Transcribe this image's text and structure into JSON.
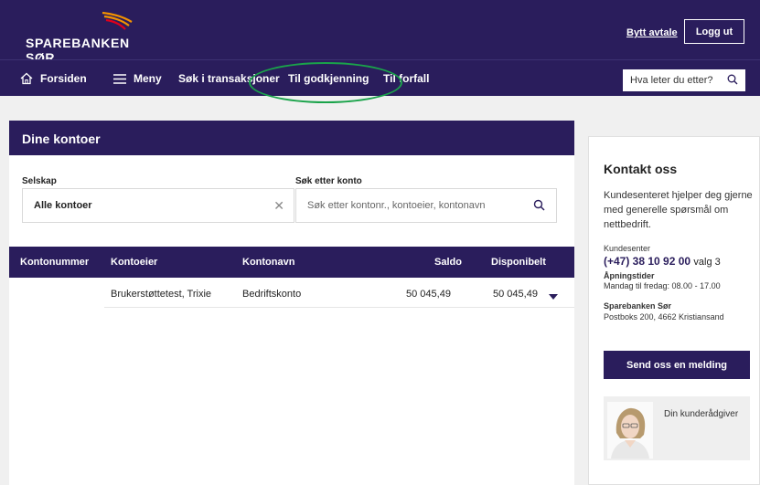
{
  "header": {
    "brand": "SPAREBANKEN SØR",
    "switch_agreement": "Bytt avtale",
    "logout": "Logg ut"
  },
  "nav": {
    "home": "Forsiden",
    "menu": "Meny",
    "search_transactions": "Søk i transaksjoner",
    "approval": "Til godkjenning",
    "due": "Til forfall",
    "search_placeholder": "Hva leter du etter?"
  },
  "accounts": {
    "title": "Dine kontoer",
    "company_label": "Selskap",
    "company_value": "Alle kontoer",
    "search_label": "Søk etter konto",
    "search_placeholder": "Søk etter kontonr., kontoeier, kontonavn",
    "columns": [
      "Kontonummer",
      "Kontoeier",
      "Kontonavn",
      "Saldo",
      "Disponibelt"
    ],
    "rows": [
      {
        "number": "",
        "owner": "Brukerstøttetest, Trixie",
        "name": "Bedriftskonto",
        "balance": "50 045,49",
        "available": "50 045,49"
      }
    ]
  },
  "contact": {
    "title": "Kontakt oss",
    "text": "Kundesenteret hjelper deg gjerne med generelle spørsmål om nettbedrift.",
    "center_label": "Kundesenter",
    "phone": "(+47) 38 10 92 00",
    "phone_suffix": "valg 3",
    "hours_label": "Åpningstider",
    "hours": "Mandag til fredag: 08.00 - 17.00",
    "bank_name": "Sparebanken Sør",
    "address": "Postboks 200, 4662 Kristiansand",
    "send_button": "Send oss en melding",
    "advisor_label": "Din kunderådgiver"
  },
  "colors": {
    "brand": "#2a1d5c",
    "highlight": "#1aa34a",
    "logo_orange": "#f39200"
  }
}
